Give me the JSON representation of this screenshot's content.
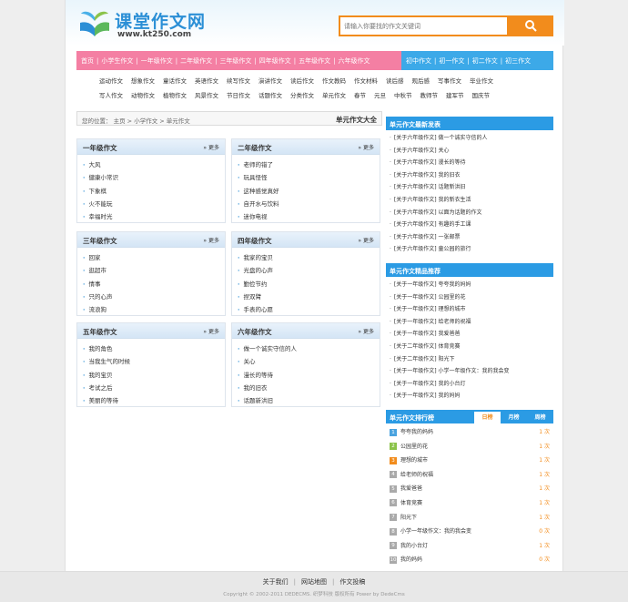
{
  "header": {
    "site_title": "课堂作文网",
    "site_url": "www.kt250.com",
    "search_placeholder": "请输入你要找的作文关键词"
  },
  "nav": {
    "primary": [
      "首页",
      "小学生作文",
      "一年级作文",
      "二年级作文",
      "三年级作文",
      "四年级作文",
      "五年级作文",
      "六年级作文"
    ],
    "secondary": [
      "初中作文",
      "初一作文",
      "初二作文",
      "初三作文"
    ]
  },
  "subnav": {
    "row1": [
      "运动作文",
      "想象作文",
      "童话作文",
      "英语作文",
      "续写作文",
      "演讲作文",
      "读后作文",
      "作文教码",
      "作文材料",
      "读后感",
      "观后感",
      "写事作文",
      "毕业作文"
    ],
    "row2": [
      "写人作文",
      "动物作文",
      "植物作文",
      "风景作文",
      "节日作文",
      "话题作文",
      "分类作文",
      "单元作文",
      "春节",
      "元旦",
      "中秋节",
      "教师节",
      "建军节",
      "国庆节"
    ]
  },
  "breadcrumb": {
    "prefix": "您的位置：",
    "home": "主页",
    "sep1": ">",
    "level1": "小学作文",
    "sep2": ">",
    "level2": "单元作文",
    "right_title": "单元作文大全"
  },
  "more_label": "» 更多",
  "boxes": [
    {
      "title": "一年级作文",
      "items": [
        "大风",
        "健康小常识",
        "下象棋",
        "火不能玩",
        "幸福时光"
      ]
    },
    {
      "title": "二年级作文",
      "items": [
        "老师的错了",
        "玩具怪怪",
        "这种感觉真好",
        "自开水与饮料",
        "迷你电视"
      ]
    },
    {
      "title": "三年级作文",
      "items": [
        "回家",
        "逛超市",
        "情事",
        "只的心声",
        "流浪狗"
      ]
    },
    {
      "title": "四年级作文",
      "items": [
        "我家的宝贝",
        "光盘的心声",
        "勤俭节约",
        "捏双臂",
        "手表的心愿"
      ]
    },
    {
      "title": "五年级作文",
      "items": [
        "我的角色",
        "当我生气的时候",
        "我的宝贝",
        "考试之后",
        "美丽的等待"
      ]
    },
    {
      "title": "六年级作文",
      "items": [
        "做一个诚实守信的人",
        "关心",
        "漫长的等待",
        "我的旧衣",
        "话题新洪旧"
      ]
    }
  ],
  "right_latest": {
    "title": "单元作文最新发表",
    "items": [
      "[关于六年级作文] 做一个诚实守信的人",
      "[关于六年级作文] 关心",
      "[关于六年级作文] 漫长的等待",
      "[关于六年级作文] 我的旧衣",
      "[关于六年级作文] 话题新洪旧",
      "[关于六年级作文] 我的新衣生活",
      "[关于六年级作文] 以面为话题的作文",
      "[关于六年级作文] 有趣的手工课",
      "[关于六年级作文] 一张邮票",
      "[关于六年级作文] 童公园的旅行"
    ]
  },
  "right_recommend": {
    "title": "单元作文精品推荐",
    "items": [
      "[关于一年级作文] 夸夸我的妈妈",
      "[关于一年级作文] 公园里的花",
      "[关于一年级作文] 理想的城市",
      "[关于一年级作文] 给老师的祝福",
      "[关于一年级作文] 我爱爸爸",
      "[关于二年级作文] 体育竞赛",
      "[关于二年级作文] 阳光下",
      "[关于一年级作文] 小学一年级作文：我的我会变",
      "[关于一年级作文] 我的小台灯",
      "[关于一年级作文] 我的妈妈"
    ]
  },
  "right_ranking": {
    "title": "单元作文排行榜",
    "tabs": [
      "日榜",
      "月榜",
      "周榜"
    ],
    "items": [
      {
        "num": "1",
        "text": "夸夸我的妈妈",
        "count": "1 次"
      },
      {
        "num": "2",
        "text": "公园里的花",
        "count": "1 次"
      },
      {
        "num": "3",
        "text": "理想的城市",
        "count": "1 次"
      },
      {
        "num": "4",
        "text": "给老师的祝福",
        "count": "1 次"
      },
      {
        "num": "5",
        "text": "我爱爸爸",
        "count": "1 次"
      },
      {
        "num": "6",
        "text": "体育竞赛",
        "count": "1 次"
      },
      {
        "num": "7",
        "text": "阳光下",
        "count": "1 次"
      },
      {
        "num": "8",
        "text": "小学一年级作文：我的我会变",
        "count": "0 次"
      },
      {
        "num": "9",
        "text": "我的小台灯",
        "count": "1 次"
      },
      {
        "num": "10",
        "text": "我的妈妈",
        "count": "0 次"
      }
    ]
  },
  "colors": {
    "orange": "#f28c1c",
    "blue": "#2b9be4",
    "pink": "#f47fa3"
  },
  "footer": {
    "links": [
      "关于我们",
      "网站地图",
      "作文投稿"
    ],
    "copyright": "Copyright © 2002-2011 DEDECMS. 织梦科技 版权所有  Power by DedeCms"
  }
}
